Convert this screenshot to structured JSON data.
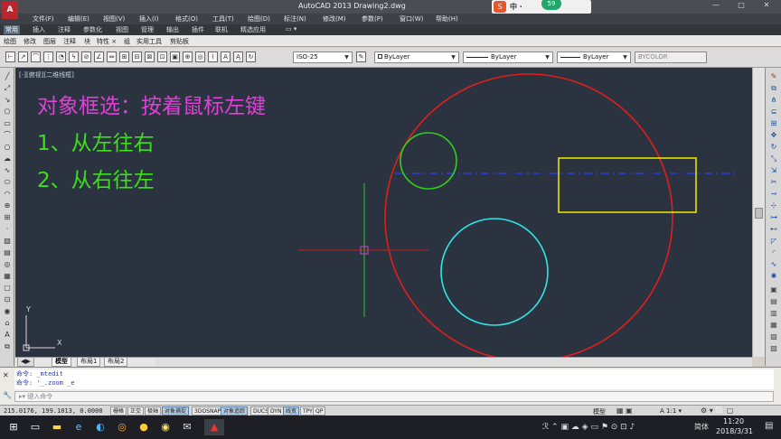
{
  "app": {
    "logo_letter": "A",
    "title": "AutoCAD 2013    Drawing2.dwg"
  },
  "window_controls": {
    "minimize": "—",
    "maximize": "□",
    "close": "✕"
  },
  "ime": {
    "logo": "S",
    "lang": "中 ·",
    "badge": "59"
  },
  "menu": [
    "文件(F)",
    "编辑(E)",
    "视图(V)",
    "插入(I)",
    "格式(O)",
    "工具(T)",
    "绘图(D)",
    "标注(N)",
    "修改(M)",
    "参数(P)",
    "窗口(W)",
    "帮助(H)"
  ],
  "ribbon_tabs": [
    "常用",
    "插入",
    "注释",
    "参数化",
    "视图",
    "管理",
    "输出",
    "插件",
    "联机",
    "精选应用"
  ],
  "ribbon_active_index": 0,
  "ribbon_panels": [
    "绘图",
    "修改",
    "图层",
    "注释",
    "块",
    "特性 ×",
    "组",
    "实用工具",
    "剪贴板"
  ],
  "toolbar": {
    "dimstyle": "ISO-25",
    "color": "ByLayer",
    "linetype": "ByLayer",
    "lineweight": "ByLayer",
    "plotstyle": "BYCOLOR"
  },
  "viewport_label": "[-][俯视][二维线框]",
  "notes": {
    "title": "对象框选：按着鼠标左键",
    "item1": "1、从左往右",
    "item2": "2、从右往左"
  },
  "ucs": {
    "x": "X",
    "y": "Y"
  },
  "layout_tabs": [
    "模型",
    "布局1",
    "布局2"
  ],
  "command": {
    "line1": "命令: _mtedit",
    "line2": "命令: '_.zoom _e",
    "input_placeholder": "键入命令"
  },
  "status": {
    "coords": "215.0176, 199.1013, 0.0000",
    "buttons": [
      {
        "label": "栅格",
        "on": false
      },
      {
        "label": "正交",
        "on": false
      },
      {
        "label": "极轴",
        "on": false
      },
      {
        "label": "对象捕捉",
        "on": true
      },
      {
        "label": "3DOSNAP",
        "on": false
      },
      {
        "label": "对象追踪",
        "on": true
      },
      {
        "label": "DUCS",
        "on": false
      },
      {
        "label": "DYN",
        "on": false
      },
      {
        "label": "线宽",
        "on": true
      },
      {
        "label": "TPY",
        "on": false
      },
      {
        "label": "QP",
        "on": false
      }
    ],
    "model": "模型",
    "scale": "A 1:1 ▾"
  },
  "taskbar": {
    "ime": "简体",
    "time": "11:20",
    "date": "2018/3/31"
  },
  "colors": {
    "canvas": "#2b3340",
    "big_circle": "#e01e1e",
    "green_circle": "#33d01a",
    "cyan_circle": "#2ee6e6",
    "yellow_rect": "#e8e000",
    "dashed_line": "#2a3cdc",
    "note_title": "#e040d8",
    "note_items": "#3ddf1a"
  }
}
